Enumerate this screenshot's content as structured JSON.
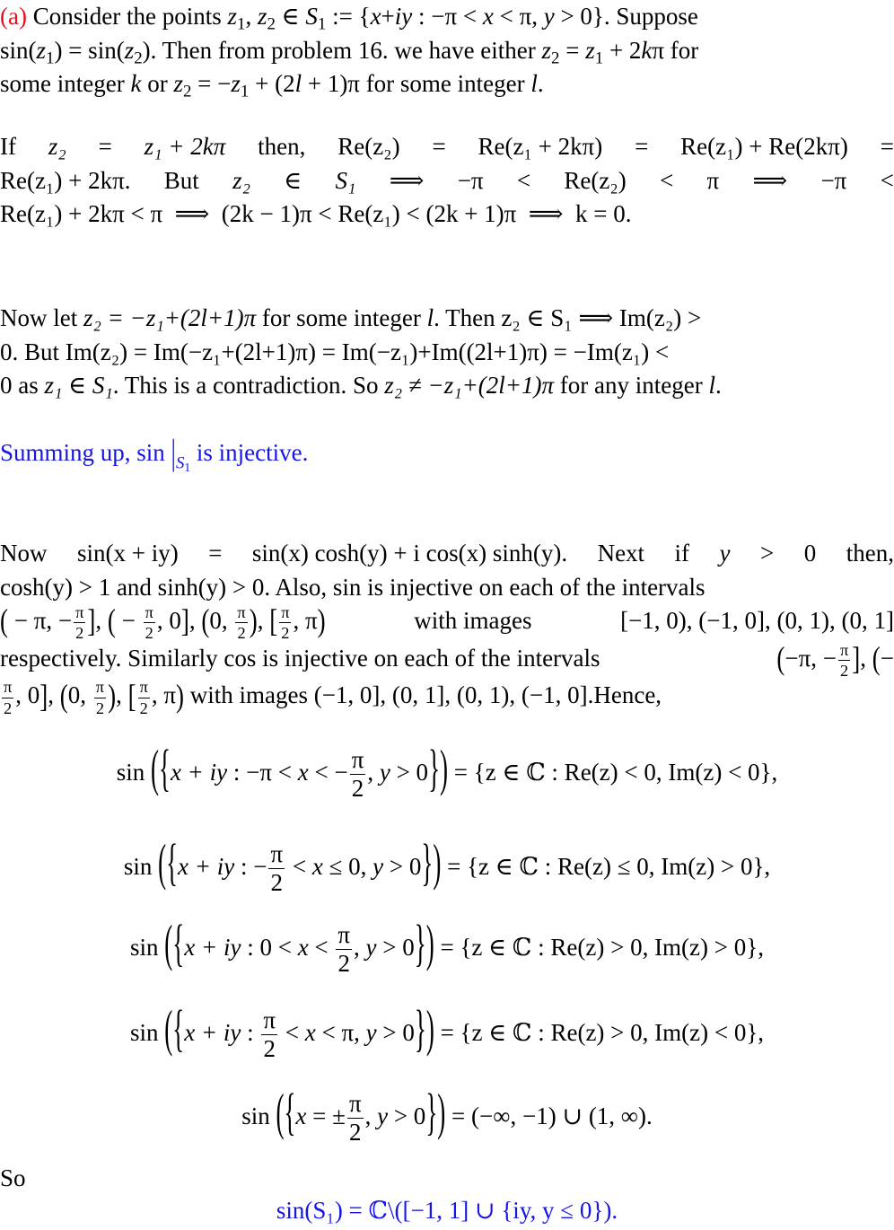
{
  "colors": {
    "text": "#000000",
    "label_red": "#e8101a",
    "highlight_blue": "#1515e8",
    "background": "#ffffff"
  },
  "part_a": {
    "label": "(a)",
    "l1": [
      "Consider the points ",
      "z",
      "1",
      ", ",
      "z",
      "2",
      " ∈ ",
      "S",
      "1",
      " := {",
      "x",
      "+",
      "iy",
      " : −π < ",
      "x",
      " < π, ",
      "y",
      " > 0}. Suppose"
    ],
    "l2": [
      "sin(",
      "z",
      "1",
      ") = sin(",
      "z",
      "2",
      "). Then from problem 16. we have either ",
      "z",
      "2",
      " = ",
      "z",
      "1",
      " + 2",
      "k",
      "π for"
    ],
    "l3": [
      "some integer ",
      "k",
      " or ",
      "z",
      "2",
      " = −",
      "z",
      "1",
      " + (2",
      "l",
      " + 1)π for some integer ",
      "l",
      "."
    ]
  },
  "case1": {
    "l1": [
      "If",
      "z₂",
      "=",
      "z₁ + 2kπ",
      "then,",
      "Re(z₂)",
      "=",
      "Re(z₁ + 2kπ)",
      "=",
      "Re(z₁) + Re(2kπ)",
      "="
    ],
    "l2": [
      "Re(z₁) + 2kπ.",
      "But",
      "z₂",
      "∈",
      "S₁",
      "⟹",
      "−π",
      "<",
      "Re(z₂)",
      "<",
      "π",
      "⟹",
      "−π",
      "<"
    ],
    "l3": "Re(z₁) + 2kπ < π  ⟹  (2k − 1)π < Re(z₁) < (2k + 1)π  ⟹  k = 0."
  },
  "case2": {
    "l1": [
      "Now let ",
      "z₂ = −z₁+(2l+1)π",
      " for some integer ",
      "l",
      ". Then ",
      "z₂ ∈ S₁ ⟹ Im(z₂) >"
    ],
    "l2": "0. But Im(z₂) = Im(−z₁+(2l+1)π) = Im(−z₁)+Im((2l+1)π) = −Im(z₁) <",
    "l3": [
      "0 as ",
      "z₁ ∈ S₁",
      ". This is a contradiction. So ",
      "z₂ ≠ −z₁+(2l+1)π",
      " for any integer ",
      "l",
      "."
    ]
  },
  "summary": {
    "prefix": "Summing up, sin",
    "restriction": "S",
    "restriction_sub": "1",
    "suffix": " is injective."
  },
  "analysis": {
    "l1": [
      "Now",
      "sin(x + iy)",
      "=",
      "sin(x) cosh(y) + i cos(x) sinh(y).",
      "Next",
      "if",
      "y",
      ">",
      "0",
      "then,"
    ],
    "l2": "cosh(y) > 1 and sinh(y) > 0. Also, sin is injective on each of the intervals",
    "l3_intervals": [
      "(−π, −π/2]",
      "(−π/2, 0]",
      "(0, π/2)",
      "[π/2, π)"
    ],
    "l3_text": "with images",
    "l3_images": "[−1, 0), (−1, 0], (0, 1), (0, 1]",
    "l4": "respectively. Similarly cos is injective on each of the intervals",
    "l5_images": "(−1, 0], (0, 1], (0, 1), (−1, 0].Hence,",
    "with_images": "with images",
    "pi": "π",
    "two": "2"
  },
  "equations": [
    {
      "domain": "−π < x < −π/2",
      "image": "= {z ∈ ℂ : Re(z) < 0, Im(z) < 0},"
    },
    {
      "domain": "−π/2 < x ≤ 0",
      "image": "= {z ∈ ℂ : Re(z) ≤ 0, Im(z) > 0},"
    },
    {
      "domain": "0 < x < π/2",
      "image": "= {z ∈ ℂ : Re(z) > 0, Im(z) > 0},"
    },
    {
      "domain": "π/2 < x < π",
      "image": "= {z ∈ ℂ : Re(z) > 0, Im(z) < 0},"
    },
    {
      "domain": "x = ±π/2",
      "image": "= (−∞, −1) ∪ (1, ∞)."
    }
  ],
  "conclusion": {
    "so": "So",
    "result": "sin(S₁) = ℂ\\([−1, 1] ∪ {iy, y ≤ 0})."
  },
  "math": {
    "sin": "sin",
    "set_prefix": "x + iy :",
    "set_suffix": ", y > 0"
  }
}
